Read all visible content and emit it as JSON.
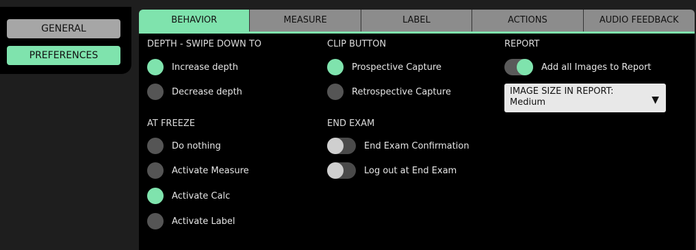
{
  "sidebar": {
    "general_label": "GENERAL",
    "preferences_label": "PREFERENCES"
  },
  "tabs": [
    {
      "label": "BEHAVIOR",
      "active": true
    },
    {
      "label": "MEASURE",
      "active": false
    },
    {
      "label": "LABEL",
      "active": false
    },
    {
      "label": "ACTIONS",
      "active": false
    },
    {
      "label": "AUDIO FEEDBACK",
      "active": false
    }
  ],
  "depth": {
    "title": "DEPTH - SWIPE DOWN TO",
    "options": [
      {
        "label": "Increase depth",
        "selected": true
      },
      {
        "label": "Decrease depth",
        "selected": false
      }
    ]
  },
  "at_freeze": {
    "title": "AT FREEZE",
    "options": [
      {
        "label": "Do nothing",
        "selected": false
      },
      {
        "label": "Activate Measure",
        "selected": false
      },
      {
        "label": "Activate Calc",
        "selected": true
      },
      {
        "label": "Activate Label",
        "selected": false
      }
    ]
  },
  "clip_button": {
    "title": "CLIP BUTTON",
    "options": [
      {
        "label": "Prospective Capture",
        "selected": true
      },
      {
        "label": "Retrospective Capture",
        "selected": false
      }
    ]
  },
  "end_exam": {
    "title": "END EXAM",
    "toggles": [
      {
        "label": "End Exam Confirmation",
        "on": false
      },
      {
        "label": "Log out at End Exam",
        "on": false
      }
    ]
  },
  "report": {
    "title": "REPORT",
    "toggle": {
      "label": "Add all Images to Report",
      "on": true
    },
    "image_size": {
      "label": "IMAGE SIZE IN REPORT:",
      "value": "Medium"
    }
  },
  "colors": {
    "accent": "#7fe3ad",
    "radio_off": "#555555",
    "tab_inactive": "#8c8c8c",
    "panel_bg": "#000000",
    "page_bg": "#1e1e1e"
  },
  "icons": {
    "dropdown_caret": "▼"
  }
}
